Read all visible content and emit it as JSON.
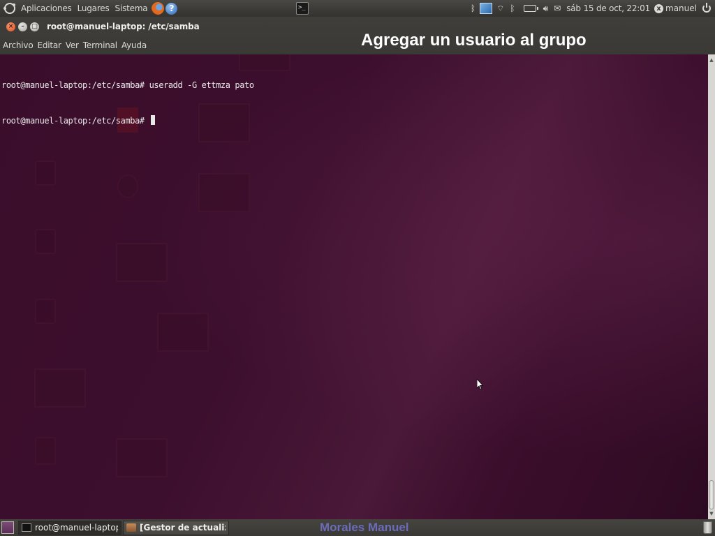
{
  "top_panel": {
    "menus": [
      "Aplicaciones",
      "Lugares",
      "Sistema"
    ],
    "launcher_icons": [
      "firefox-icon",
      "help-icon",
      "terminal-icon"
    ],
    "tray_icons": [
      "bluetooth-icon",
      "network-icon",
      "wifi-icon",
      "bluetooth-icon",
      "battery-icon",
      "volume-icon",
      "mail-icon"
    ],
    "clock": "sáb 15 de oct, 22:01",
    "user": "manuel"
  },
  "window": {
    "title": "root@manuel-laptop: /etc/samba",
    "menus": [
      "Archivo",
      "Editar",
      "Ver",
      "Terminal",
      "Ayuda"
    ]
  },
  "overlay_caption": "Agregar un usuario al grupo",
  "terminal": {
    "lines": [
      "root@manuel-laptop:/etc/samba# useradd -G ettmza pato",
      "root@manuel-laptop:/etc/samba# "
    ],
    "colors": {
      "background": "#3d0f2e",
      "foreground": "#e8e8e8"
    }
  },
  "taskbar": {
    "items": [
      {
        "label": "root@manuel-laptop: /e...",
        "icon": "terminal-icon",
        "active": true
      },
      {
        "label": "[Gestor de actualiza...",
        "icon": "update-manager-icon",
        "active": false
      }
    ],
    "author": "Morales Manuel"
  }
}
